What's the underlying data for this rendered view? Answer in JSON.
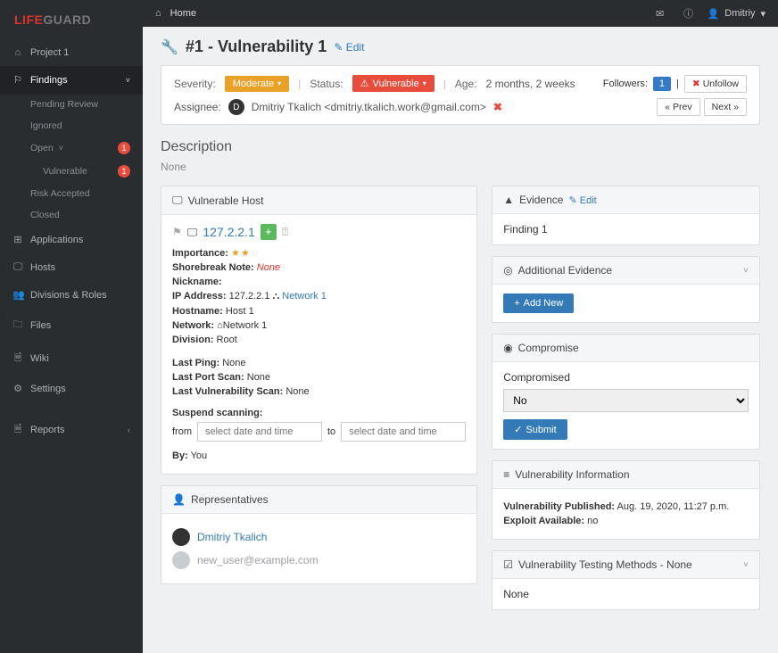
{
  "brand": {
    "part1": "LIFE",
    "part2": "GUARD"
  },
  "topbar": {
    "home_icon": "⌂",
    "home": "Home",
    "mail_icon": "✉",
    "info_icon": "ⓘ",
    "user_avatar_icon": "👤",
    "user": "Dmitriy",
    "caret": "▾"
  },
  "sidebar": {
    "project": {
      "icon": "⌂",
      "label": "Project 1"
    },
    "findings": {
      "icon": "⚐",
      "label": "Findings",
      "chev": "˅"
    },
    "pending": {
      "label": "Pending Review"
    },
    "ignored": {
      "label": "Ignored"
    },
    "open": {
      "label": "Open",
      "chev": "˅",
      "badge": "1"
    },
    "vulnerable": {
      "label": "Vulnerable",
      "badge": "1"
    },
    "risk_accepted": {
      "label": "Risk Accepted"
    },
    "closed": {
      "label": "Closed"
    },
    "applications": {
      "icon": "⊞",
      "label": "Applications"
    },
    "hosts": {
      "icon": "🖵",
      "label": "Hosts"
    },
    "divisions": {
      "icon": "👥",
      "label": "Divisions & Roles"
    },
    "files": {
      "icon": "🗀",
      "label": "Files"
    },
    "wiki": {
      "icon": "🗎",
      "label": "Wiki"
    },
    "settings": {
      "icon": "⚙",
      "label": "Settings"
    },
    "reports": {
      "icon": "🗎",
      "label": "Reports",
      "chev": "‹"
    }
  },
  "title": {
    "wrench": "🔧",
    "text": "#1 - Vulnerability 1",
    "edit_icon": "✎",
    "edit": "Edit"
  },
  "meta": {
    "severity_label": "Severity:",
    "severity_value": "Moderate",
    "caret": "▾",
    "status_label": "Status:",
    "status_icon": "⚠",
    "status_value": "Vulnerable",
    "age_label": "Age:",
    "age_value": "2 months, 2 weeks",
    "sep": "|"
  },
  "assignee": {
    "label": "Assignee:",
    "avatar_icon": "D",
    "text": "Dmitriy Tkalich <dmitriy.tkalich.work@gmail.com>",
    "remove": "✖"
  },
  "followers": {
    "label": "Followers:",
    "count": "1",
    "sep": "|",
    "unfollow_icon": "✖",
    "unfollow": "Unfollow",
    "prev": "« Prev",
    "next": "Next »"
  },
  "description": {
    "heading": "Description",
    "value": "None"
  },
  "host_card": {
    "header_icon": "🖵",
    "header": "Vulnerable Host",
    "flag_icon": "⚑",
    "monitor_icon": "🖵",
    "ip_link": "127.2.2.1",
    "plus": "+",
    "q": "⍰",
    "importance_label": "Importance:",
    "stars_full": "★★",
    "stars_dim": "☆",
    "shorebreak_label": "Shorebreak Note:",
    "shorebreak_value": "None",
    "nickname_label": "Nickname:",
    "ip_label": "IP Address:",
    "ip_value": "127.2.2.1",
    "net_icon": "⛬",
    "net_link": "Network 1",
    "hostname_label": "Hostname:",
    "hostname_value": "Host 1",
    "network_label": "Network:",
    "network_icon": "⌂",
    "network_value": "Network 1",
    "division_label": "Division:",
    "division_value": "Root",
    "last_ping_label": "Last Ping:",
    "last_ping_value": "None",
    "last_port_label": "Last Port Scan:",
    "last_port_value": "None",
    "last_vuln_label": "Last Vulnerability Scan:",
    "last_vuln_value": "None",
    "suspend_label": "Suspend scanning:",
    "from_label": "from",
    "to_label": "to",
    "dt_placeholder": "select date and time",
    "by_label": "By:",
    "by_value": "You"
  },
  "reps_card": {
    "header_icon": "👤",
    "header": "Representatives",
    "rep1": "Dmitriy Tkalich",
    "rep2": "new_user@example.com"
  },
  "evidence_card": {
    "header_icon": "▲",
    "header": "Evidence",
    "edit_icon": "✎",
    "edit": "Edit",
    "body": "Finding 1"
  },
  "add_evidence_card": {
    "header_icon": "◎",
    "header": "Additional Evidence",
    "collapse": "˅",
    "add_icon": "+",
    "add_label": "Add New"
  },
  "compromise_card": {
    "header_icon": "◉",
    "header": "Compromise",
    "field_label": "Compromised",
    "field_value": "No",
    "submit_icon": "✓",
    "submit": "Submit"
  },
  "vuln_info_card": {
    "header_icon": "≡",
    "header": "Vulnerability Information",
    "published_label": "Vulnerability Published:",
    "published_value": "Aug. 19, 2020, 11:27 p.m.",
    "exploit_label": "Exploit Available:",
    "exploit_value": "no"
  },
  "testing_card": {
    "header_icon": "☑",
    "header": "Vulnerability Testing Methods - None",
    "collapse": "˅",
    "body": "None"
  }
}
